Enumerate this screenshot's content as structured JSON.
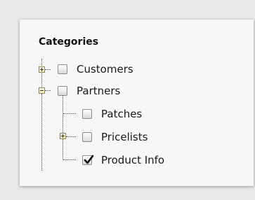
{
  "panel": {
    "title": "Categories"
  },
  "tree": {
    "items": [
      {
        "label": "Customers",
        "checked": false,
        "expander": "plus-icon"
      },
      {
        "label": "Partners",
        "checked": false,
        "expander": "minus-icon"
      },
      {
        "label": "Patches",
        "checked": false,
        "expander": ""
      },
      {
        "label": "Pricelists",
        "checked": false,
        "expander": "plus-icon"
      },
      {
        "label": "Product Info",
        "checked": true,
        "expander": ""
      }
    ]
  },
  "colors": {
    "background": "#e8e8e8",
    "panel": "#f7f7f7",
    "expander_fill": "#f1e8b8",
    "expander_border": "#8a8a5a"
  }
}
